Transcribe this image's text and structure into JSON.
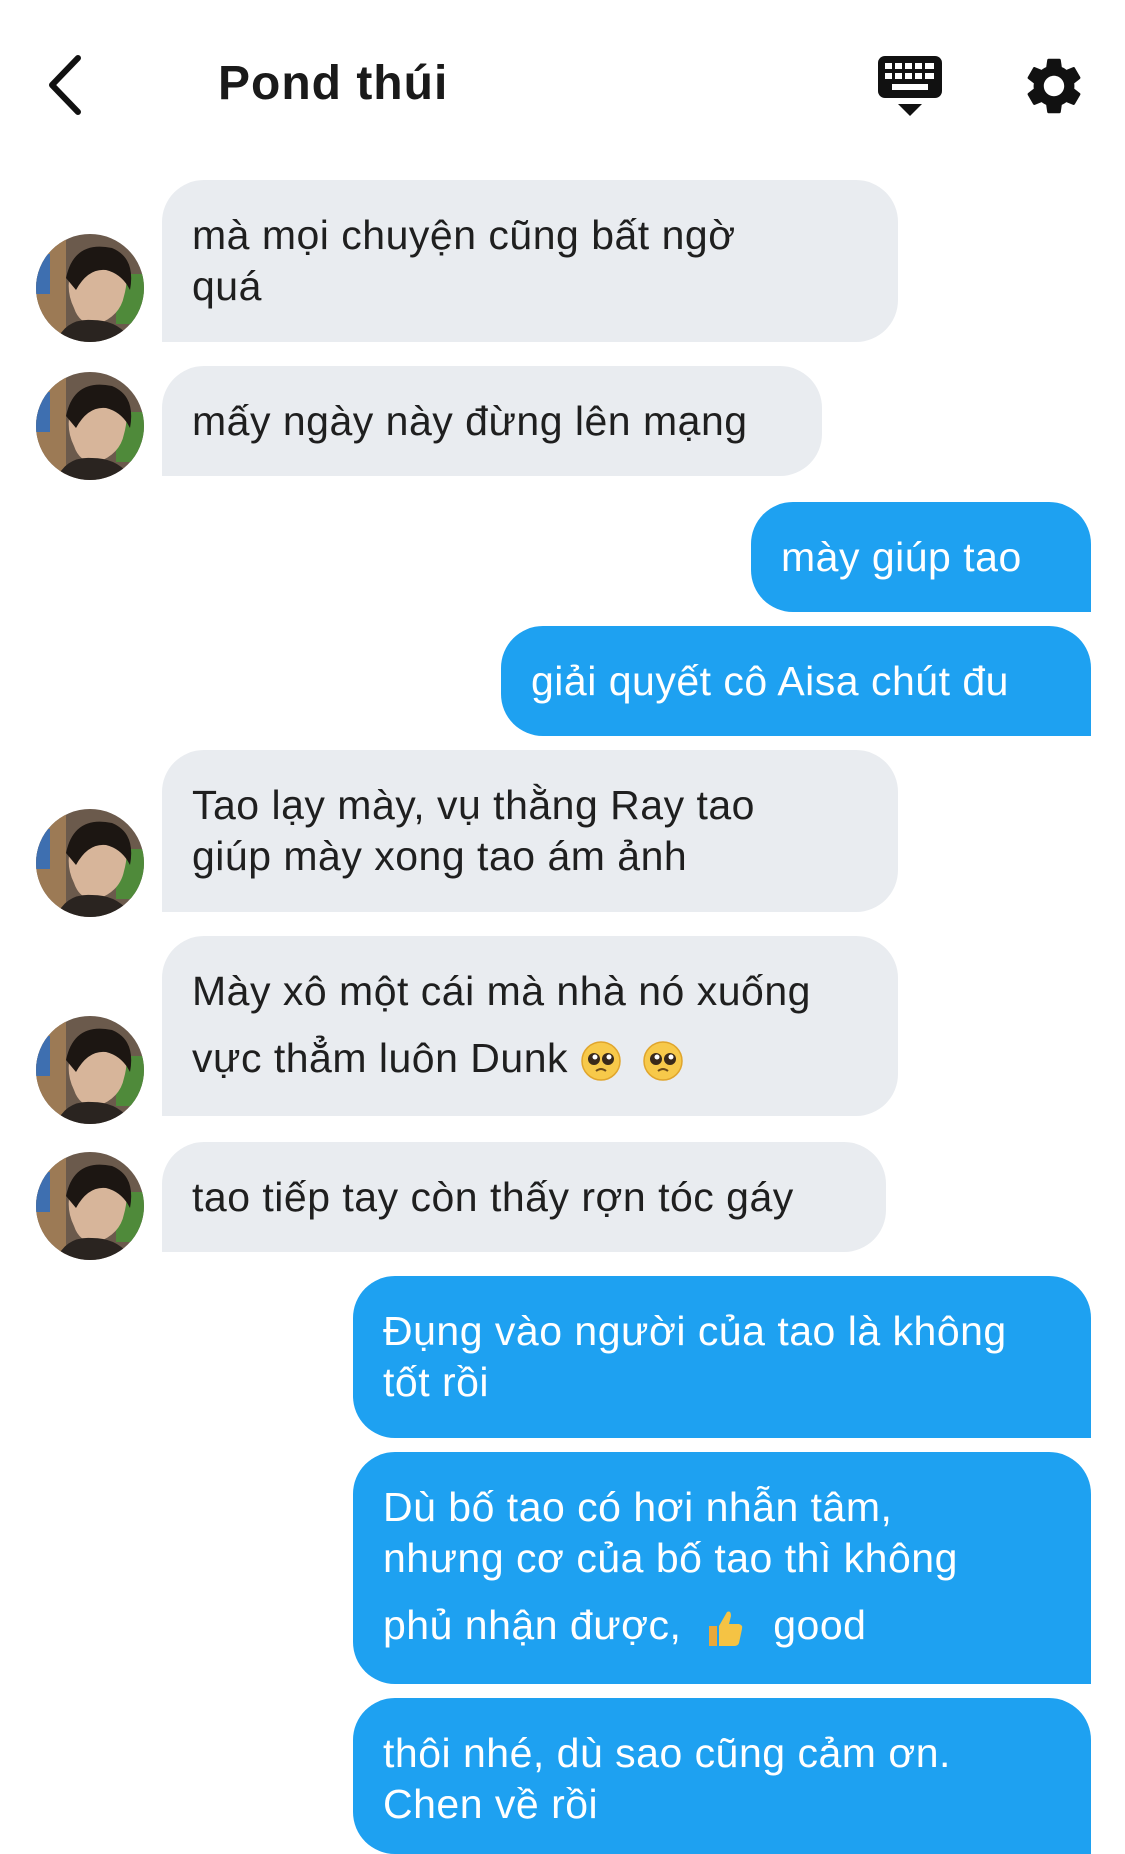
{
  "header": {
    "title": "Pond thúi"
  },
  "colors": {
    "incoming_bubble": "#e9ecf0",
    "outgoing_bubble": "#1ea1f1",
    "incoming_text": "#1f1f1f",
    "outgoing_text": "#ffffff"
  },
  "icons": {
    "back": "chevron-left-icon",
    "keyboard": "keyboard-icon",
    "settings": "gear-icon",
    "avatar": "contact-avatar",
    "emoji_pleading": "pleading-face-icon",
    "emoji_thumbs": "thumbs-up-icon"
  },
  "messages": [
    {
      "side": "in",
      "lines": [
        "mà mọi chuyện cũng bất ngờ",
        "quá"
      ]
    },
    {
      "side": "in",
      "lines": [
        "mấy ngày này đừng lên mạng"
      ]
    },
    {
      "side": "out",
      "lines": [
        "mày giúp tao"
      ]
    },
    {
      "side": "out",
      "lines": [
        "giải quyết cô Aisa chút đu"
      ]
    },
    {
      "side": "in",
      "lines": [
        "Tao lạy mày, vụ thằng Ray tao",
        "giúp mày xong tao ám ảnh"
      ]
    },
    {
      "side": "in",
      "lines": [
        "Mày xô một cái mà nhà nó xuống",
        "vực thẳm luôn Dunk"
      ]
    },
    {
      "side": "in",
      "lines": [
        "tao tiếp tay còn thấy rợn tóc gáy"
      ]
    },
    {
      "side": "out",
      "lines": [
        "Đụng vào người của tao là không",
        "tốt rồi"
      ]
    },
    {
      "side": "out",
      "lines": [
        "Dù bố tao có hơi nhẫn tâm,",
        "nhưng cơ của bố tao thì không",
        "phủ nhận được,",
        "good"
      ]
    },
    {
      "side": "out",
      "lines": [
        "thôi nhé, dù sao cũng cảm ơn.",
        "Chen về rồi"
      ]
    }
  ]
}
